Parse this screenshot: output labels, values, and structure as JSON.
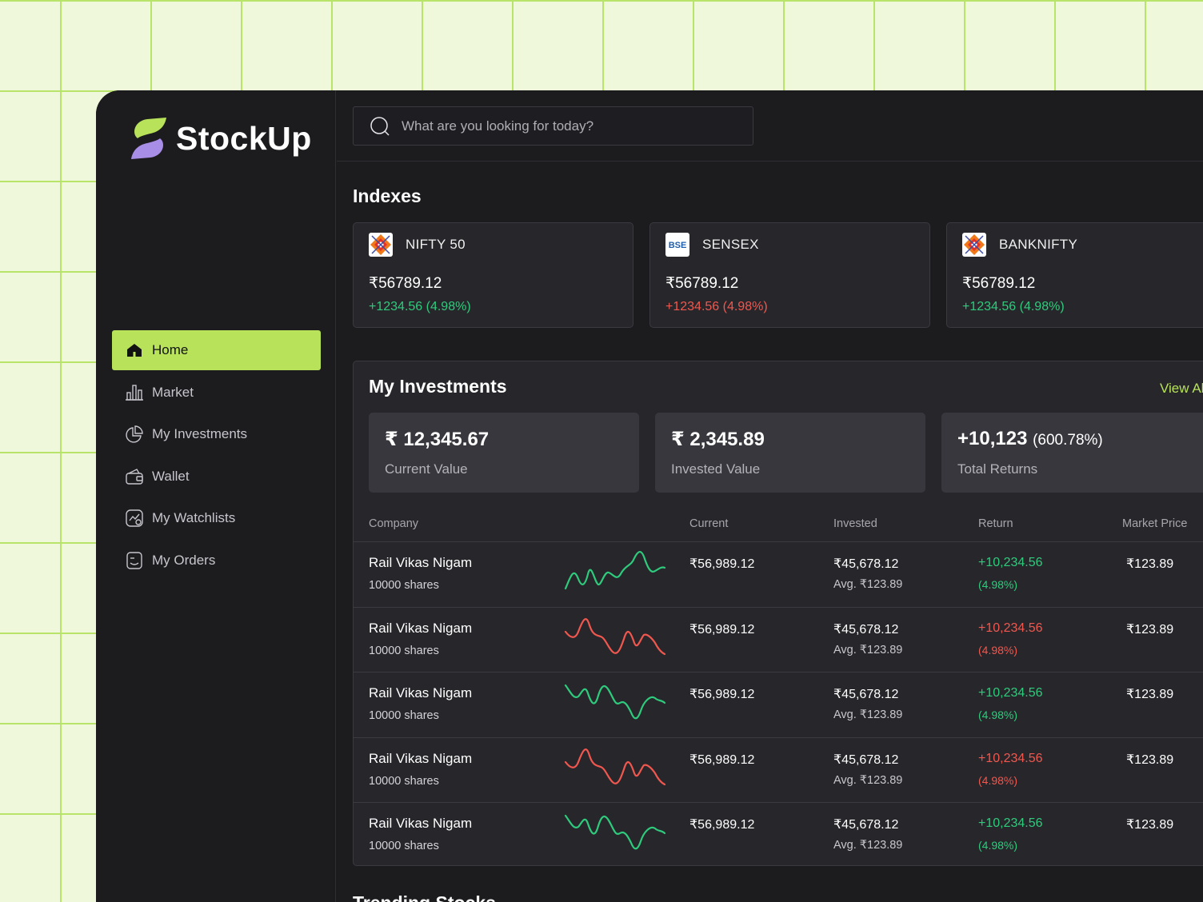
{
  "brand": {
    "name": "StockUp"
  },
  "search": {
    "placeholder": "What are you looking for today?"
  },
  "sidebar": {
    "items": [
      {
        "label": "Home",
        "icon": "home-icon",
        "active": true
      },
      {
        "label": "Market",
        "icon": "bar-chart-icon"
      },
      {
        "label": "My Investments",
        "icon": "pie-chart-icon"
      },
      {
        "label": "Wallet",
        "icon": "wallet-icon"
      },
      {
        "label": "My Watchlists",
        "icon": "watchlist-icon"
      },
      {
        "label": "My Orders",
        "icon": "orders-icon"
      }
    ]
  },
  "indexes": {
    "title": "Indexes",
    "cards": [
      {
        "name": "NIFTY 50",
        "value": "₹56789.12",
        "change": "+1234.56 (4.98%)",
        "trend": "up",
        "logo": "nse-logo"
      },
      {
        "name": "SENSEX",
        "value": "₹56789.12",
        "change": "+1234.56 (4.98%)",
        "trend": "down",
        "logo": "bse-logo"
      },
      {
        "name": "BANKNIFTY",
        "value": "₹56789.12",
        "change": "+1234.56 (4.98%)",
        "trend": "up",
        "logo": "nse-logo"
      }
    ]
  },
  "investments": {
    "title": "My Investments",
    "view_all": "View All",
    "stats": [
      {
        "value": "₹ 12,345.67",
        "label": "Current Value"
      },
      {
        "value": "₹ 2,345.89",
        "label": "Invested Value"
      },
      {
        "value": "+10,123",
        "pct": "(600.78%)",
        "label": "Total Returns"
      }
    ],
    "columns": [
      "Company",
      "Current",
      "Invested",
      "Return",
      "Market Price"
    ],
    "rows": [
      {
        "company": "Rail Vikas Nigam",
        "shares": "10000 shares",
        "current": "₹56,989.12",
        "invested": "₹45,678.12",
        "avg": "Avg. ₹123.89",
        "return": "+10,234.56",
        "return_pct": "(4.98%)",
        "trend": "up",
        "market_price": "₹123.89"
      },
      {
        "company": "Rail Vikas Nigam",
        "shares": "10000 shares",
        "current": "₹56,989.12",
        "invested": "₹45,678.12",
        "avg": "Avg. ₹123.89",
        "return": "+10,234.56",
        "return_pct": "(4.98%)",
        "trend": "down",
        "market_price": "₹123.89"
      },
      {
        "company": "Rail Vikas Nigam",
        "shares": "10000 shares",
        "current": "₹56,989.12",
        "invested": "₹45,678.12",
        "avg": "Avg. ₹123.89",
        "return": "+10,234.56",
        "return_pct": "(4.98%)",
        "trend": "up",
        "market_price": "₹123.89"
      },
      {
        "company": "Rail Vikas Nigam",
        "shares": "10000 shares",
        "current": "₹56,989.12",
        "invested": "₹45,678.12",
        "avg": "Avg. ₹123.89",
        "return": "+10,234.56",
        "return_pct": "(4.98%)",
        "trend": "down",
        "market_price": "₹123.89"
      },
      {
        "company": "Rail Vikas Nigam",
        "shares": "10000 shares",
        "current": "₹56,989.12",
        "invested": "₹45,678.12",
        "avg": "Avg. ₹123.89",
        "return": "+10,234.56",
        "return_pct": "(4.98%)",
        "trend": "up",
        "market_price": "₹123.89"
      }
    ]
  },
  "next_section": {
    "title": "Trending Stocks"
  },
  "colors": {
    "accent": "#b7e25a",
    "positive": "#2fcb7d",
    "negative": "#f0584f",
    "background": "#1c1c1f",
    "card": "#26262b"
  }
}
